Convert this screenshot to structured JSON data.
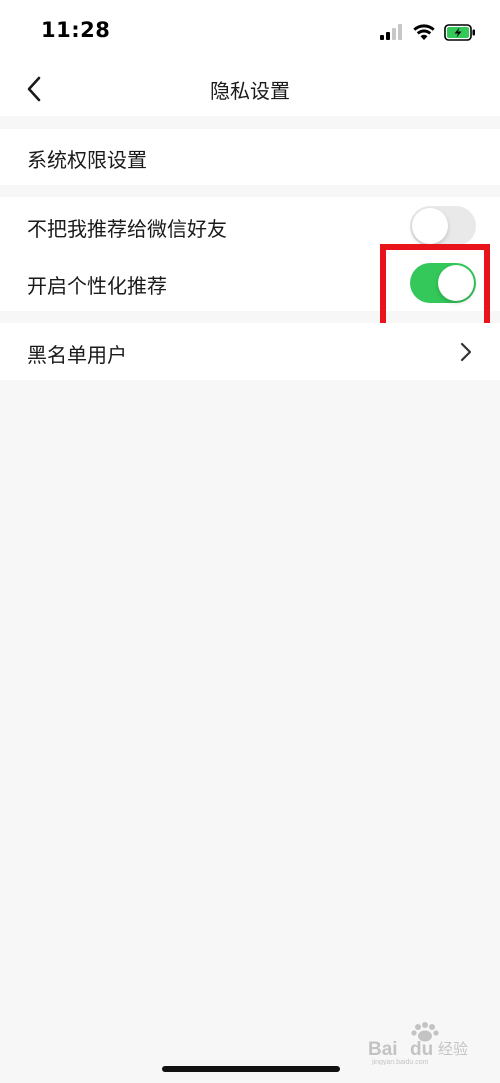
{
  "status_bar": {
    "time": "11:28",
    "icons": [
      "signal-icon",
      "wifi-icon",
      "battery-charging-icon"
    ]
  },
  "nav": {
    "title": "隐私设置",
    "back_icon": "chevron-left-icon"
  },
  "settings": {
    "system_permissions": {
      "label": "系统权限设置"
    },
    "no_recommend_wechat_friends": {
      "label": "不把我推荐给微信好友",
      "enabled": false
    },
    "personalized_recommend": {
      "label": "开启个性化推荐",
      "enabled": true
    },
    "blacklist": {
      "label": "黑名单用户",
      "icon": "chevron-right-icon"
    }
  },
  "colors": {
    "toggle_on": "#34c759",
    "toggle_off": "#e9e9ea",
    "highlight": "#e8131b",
    "background": "#f7f7f7"
  },
  "watermark": {
    "text": "Bai du 经验",
    "subtext": "jingyan.baidu.com"
  }
}
